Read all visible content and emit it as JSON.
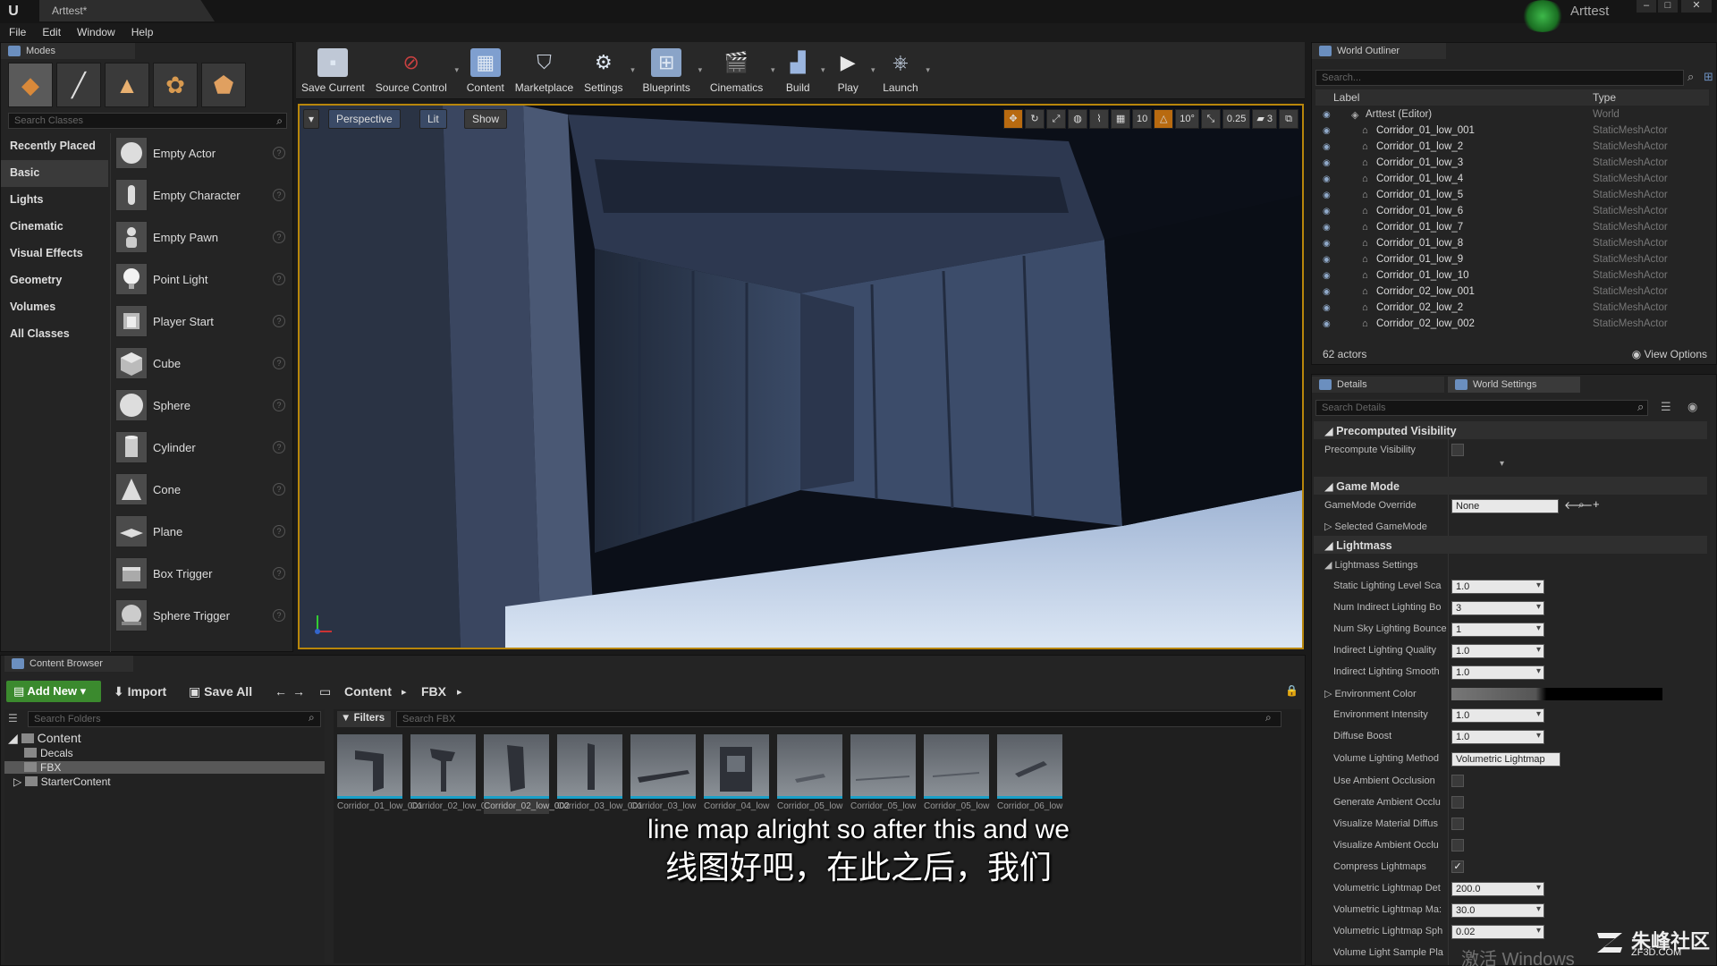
{
  "titlebar": {
    "tab_title": "Arttest*",
    "project_name": "Arttest",
    "minimize": "–",
    "maximize": "□",
    "close": "✕"
  },
  "menu": [
    "File",
    "Edit",
    "Window",
    "Help"
  ],
  "modes": {
    "tab_label": "Modes",
    "search_placeholder": "Search Classes",
    "categories": [
      "Recently Placed",
      "Basic",
      "Lights",
      "Cinematic",
      "Visual Effects",
      "Geometry",
      "Volumes",
      "All Classes"
    ],
    "actors": [
      "Empty Actor",
      "Empty Character",
      "Empty Pawn",
      "Point Light",
      "Player Start",
      "Cube",
      "Sphere",
      "Cylinder",
      "Cone",
      "Plane",
      "Box Trigger",
      "Sphere Trigger"
    ]
  },
  "toolbar": {
    "buttons": [
      "Save Current",
      "Source Control",
      "Content",
      "Marketplace",
      "Settings",
      "Blueprints",
      "Cinematics",
      "Build",
      "Play",
      "Launch"
    ]
  },
  "viewport": {
    "perspective": "Perspective",
    "lit": "Lit",
    "show": "Show",
    "grid_snap": "10",
    "rotation_snap": "10°",
    "scale_snap": "0.25",
    "camera_speed": "3"
  },
  "outliner": {
    "tab_label": "World Outliner",
    "search_placeholder": "Search...",
    "col_label": "Label",
    "col_type": "Type",
    "rows": [
      {
        "label": "Arttest (Editor)",
        "type": "World"
      },
      {
        "label": "Corridor_01_low_001",
        "type": "StaticMeshActor"
      },
      {
        "label": "Corridor_01_low_2",
        "type": "StaticMeshActor"
      },
      {
        "label": "Corridor_01_low_3",
        "type": "StaticMeshActor"
      },
      {
        "label": "Corridor_01_low_4",
        "type": "StaticMeshActor"
      },
      {
        "label": "Corridor_01_low_5",
        "type": "StaticMeshActor"
      },
      {
        "label": "Corridor_01_low_6",
        "type": "StaticMeshActor"
      },
      {
        "label": "Corridor_01_low_7",
        "type": "StaticMeshActor"
      },
      {
        "label": "Corridor_01_low_8",
        "type": "StaticMeshActor"
      },
      {
        "label": "Corridor_01_low_9",
        "type": "StaticMeshActor"
      },
      {
        "label": "Corridor_01_low_10",
        "type": "StaticMeshActor"
      },
      {
        "label": "Corridor_02_low_001",
        "type": "StaticMeshActor"
      },
      {
        "label": "Corridor_02_low_2",
        "type": "StaticMeshActor"
      },
      {
        "label": "Corridor_02_low_002",
        "type": "StaticMeshActor"
      }
    ],
    "actor_count": "62 actors",
    "view_options": "View Options"
  },
  "details": {
    "tab_details": "Details",
    "tab_world_settings": "World Settings",
    "search_placeholder": "Search Details",
    "sec_precomputed": "Precomputed Visibility",
    "precompute_visibility": "Precompute Visibility",
    "sec_gamemode": "Game Mode",
    "gamemode_override": "GameMode Override",
    "gamemode_value": "None",
    "selected_gamemode": "Selected GameMode",
    "sec_lightmass": "Lightmass",
    "lightmass_settings": "Lightmass Settings",
    "props": [
      {
        "label": "Static Lighting Level Sca",
        "value": "1.0"
      },
      {
        "label": "Num Indirect Lighting Bo",
        "value": "3"
      },
      {
        "label": "Num Sky Lighting Bounce",
        "value": "1"
      },
      {
        "label": "Indirect Lighting Quality",
        "value": "1.0"
      },
      {
        "label": "Indirect Lighting Smooth",
        "value": "1.0"
      }
    ],
    "environment_color": "Environment Color",
    "props2": [
      {
        "label": "Environment Intensity",
        "value": "1.0"
      },
      {
        "label": "Diffuse Boost",
        "value": "1.0"
      }
    ],
    "volume_lighting_method": "Volume Lighting Method",
    "volume_lighting_value": "Volumetric Lightmap",
    "checks": [
      {
        "label": "Use Ambient Occlusion",
        "checked": false
      },
      {
        "label": "Generate Ambient Occlu",
        "checked": false
      },
      {
        "label": "Visualize Material Diffus",
        "checked": false
      },
      {
        "label": "Visualize Ambient Occlu",
        "checked": false
      },
      {
        "label": "Compress Lightmaps",
        "checked": true
      }
    ],
    "props3": [
      {
        "label": "Volumetric Lightmap Det",
        "value": "200.0"
      },
      {
        "label": "Volumetric Lightmap Ma:",
        "value": "30.0"
      },
      {
        "label": "Volumetric Lightmap Sph",
        "value": "0.02"
      }
    ],
    "last_row": "Volume Light Sample Pla"
  },
  "content_browser": {
    "tab_label": "Content Browser",
    "add_new": "Add New",
    "import": "Import",
    "save_all": "Save All",
    "path": [
      "Content",
      "FBX"
    ],
    "folder_search_placeholder": "Search Folders",
    "folders": [
      "Content",
      "Decals",
      "FBX",
      "StarterContent"
    ],
    "filters": "Filters",
    "fbx_search_placeholder": "Search FBX",
    "assets": [
      "Corridor_01_low_001",
      "Corridor_02_low_001",
      "Corridor_02_low_002",
      "Corridor_03_low_001",
      "Corridor_03_low",
      "Corridor_04_low",
      "Corridor_05_low",
      "Corridor_05_low",
      "Corridor_05_low",
      "Corridor_06_low"
    ]
  },
  "subtitles": {
    "en": "line map alright so after this and we",
    "zh": "线图好吧，在此之后，我们"
  },
  "watermark": {
    "main": "朱峰社区",
    "sub": "ZF3D.COM",
    "windows": "激活 Windows"
  }
}
